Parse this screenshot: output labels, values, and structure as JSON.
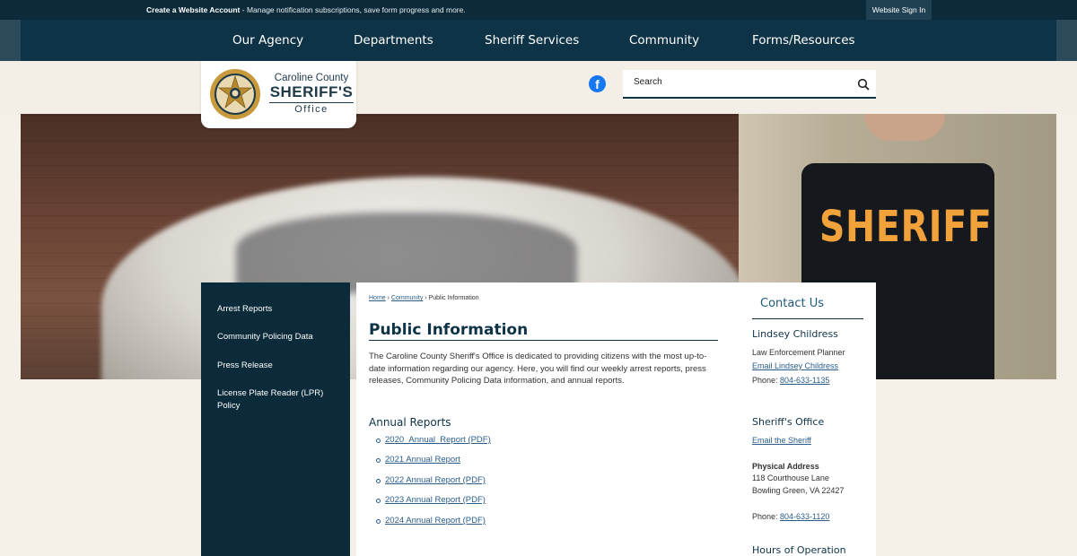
{
  "topbar": {
    "create_account": "Create a Website Account",
    "create_account_desc": " - Manage notification subscriptions, save form progress and more.",
    "sign_in": "Website Sign In"
  },
  "nav": [
    "Our Agency",
    "Departments",
    "Sheriff Services",
    "Community",
    "Forms/Resources"
  ],
  "logo": {
    "line1": "Caroline County",
    "line2": "SHERIFF'S",
    "line3": "Office"
  },
  "search": {
    "placeholder": "Search"
  },
  "hero": {
    "vest_text": "SHERIFF"
  },
  "sidebar": {
    "items": [
      {
        "label": "Arrest Reports"
      },
      {
        "label": "Community Policing Data"
      },
      {
        "label": "Press Release"
      },
      {
        "label": "License Plate Reader (LPR) Policy"
      }
    ]
  },
  "breadcrumb": {
    "home": "Home",
    "sep1": " › ",
    "community": "Community",
    "sep2": " › ",
    "current": "Public Information"
  },
  "main": {
    "title": "Public Information",
    "intro": "The Caroline County Sheriff's Office is dedicated to providing citizens with the most up-to-date information regarding our agency. Here, you will find our weekly arrest reports, press releases, Community Policing Data information, and annual reports.",
    "annual_heading": "Annual Reports",
    "annual_reports": [
      {
        "label": "2020_Annual_Report (PDF)"
      },
      {
        "label": "2021 Annual Report"
      },
      {
        "label": "2022 Annual Report (PDF)"
      },
      {
        "label": "2023 Annual Report (PDF)"
      },
      {
        "label": "2024 Annual Report (PDF)"
      }
    ]
  },
  "contact": {
    "title": "Contact Us",
    "person_name": "Lindsey Childress",
    "person_title": "Law Enforcement Planner",
    "person_email": "Email Lindsey Childress",
    "phone_label": "Phone: ",
    "person_phone": "804-633-1135",
    "office_heading": "Sheriff's Office",
    "office_email": "Email the Sheriff",
    "address_label": "Physical Address",
    "address1": "118 Courthouse Lane",
    "address2": "Bowling Green, VA 22427",
    "office_phone": "804-633-1120",
    "hours_heading": "Hours of Operation"
  },
  "colors": {
    "navy": "#0e3346",
    "link": "#2a5d8a",
    "facebook": "#1877f2",
    "vest_text": "#f2a23a"
  }
}
